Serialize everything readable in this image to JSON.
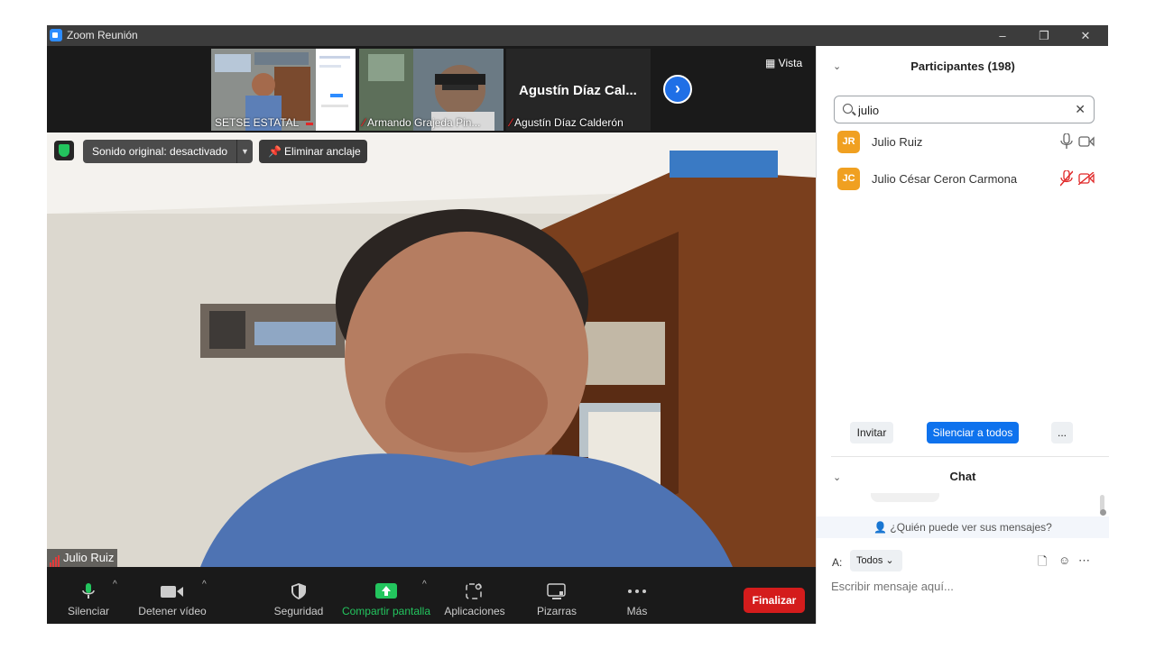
{
  "window": {
    "title": "Zoom Reunión",
    "minimize": "–",
    "restore": "❐",
    "close": "✕"
  },
  "thumbnails": [
    {
      "name": "SETSE ESTATAL",
      "muted": false
    },
    {
      "name": "Armando Grajeda Pin...",
      "muted": true
    },
    {
      "name": "Agustín Díaz Calderón",
      "display_name": "Agustín Díaz Cal...",
      "muted": true
    }
  ],
  "view_button": "Vista",
  "video": {
    "original_sound": "Sonido original: desactivado",
    "unpin": "Eliminar anclaje",
    "speaker_name": "Julio Ruiz"
  },
  "toolbar": {
    "mute": "Silenciar",
    "stop_video": "Detener vídeo",
    "security": "Seguridad",
    "share_screen": "Compartir pantalla",
    "apps": "Aplicaciones",
    "whiteboards": "Pizarras",
    "more": "Más",
    "end": "Finalizar"
  },
  "participants": {
    "title": "Participantes (198)",
    "search_value": "julio",
    "list": [
      {
        "initials": "JR",
        "name": "Julio Ruiz",
        "mic_muted": false,
        "video_off": false
      },
      {
        "initials": "JC",
        "name": "Julio César Ceron Carmona",
        "mic_muted": true,
        "video_off": true
      }
    ],
    "invite": "Invitar",
    "mute_all": "Silenciar a todos",
    "more": "..."
  },
  "chat": {
    "title": "Chat",
    "who_sees": "¿Quién puede ver sus mensajes?",
    "to_label": "A:",
    "recipient": "Todos",
    "placeholder": "Escribir mensaje aquí..."
  },
  "colors": {
    "accent_blue": "#0e72ed",
    "end_red": "#d41c1c",
    "share_green": "#23c55e",
    "muted_red": "#e02828",
    "avatar_orange": "#f0a021"
  }
}
